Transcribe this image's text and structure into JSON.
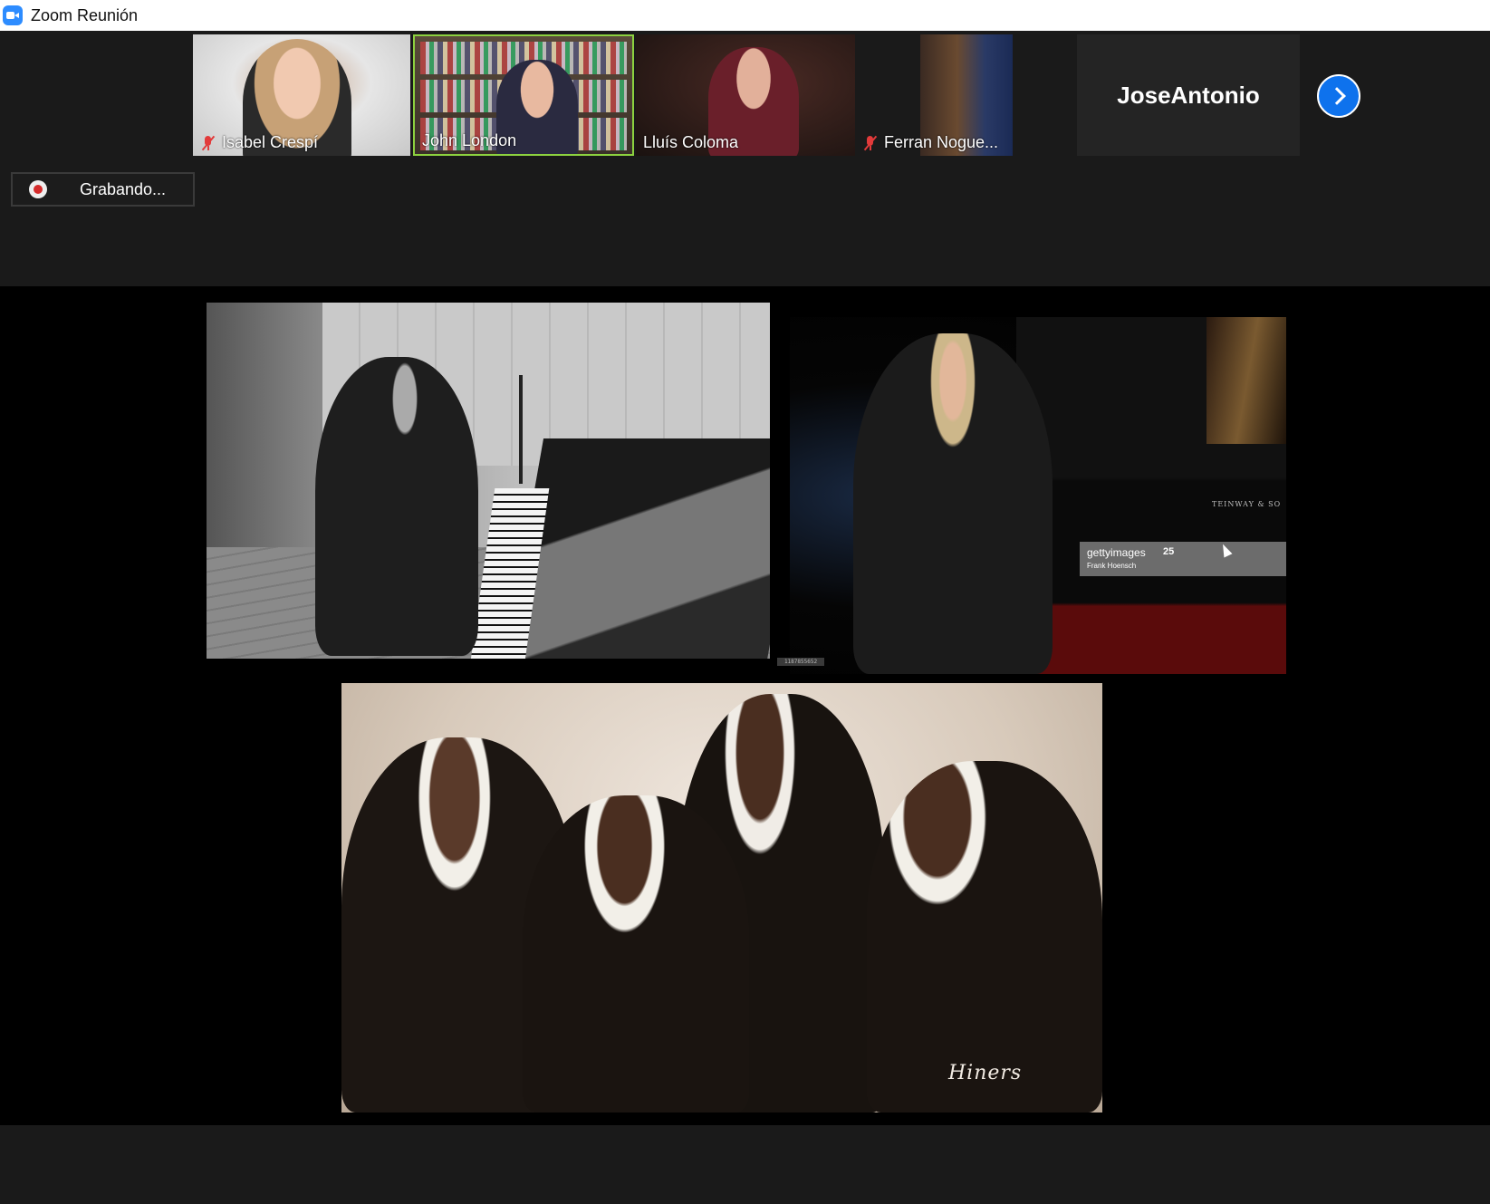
{
  "window": {
    "title": "Zoom Reunión"
  },
  "participants": [
    {
      "name": "Isabel Crespí",
      "muted": true
    },
    {
      "name": "John London",
      "muted": false,
      "active_speaker": true
    },
    {
      "name": "Lluís Coloma",
      "muted": false
    },
    {
      "name": "Ferran Nogue...",
      "muted": true
    },
    {
      "name": "JoseAntonio",
      "video": false
    }
  ],
  "recording": {
    "label": "Grabando..."
  },
  "shared_screen": {
    "photo2": {
      "piano_brand": "TEINWAY & SO",
      "watermark": {
        "brand": "gettyimages",
        "badge": "25",
        "credit": "Frank Hoensch"
      },
      "image_id": "1187855652"
    },
    "photo3": {
      "signature": "Hiners"
    }
  },
  "colors": {
    "active_speaker_border": "#8cd13f",
    "next_button": "#0e72ed",
    "recording_dot": "#d52b2b",
    "mute_icon": "#e23a3a"
  }
}
